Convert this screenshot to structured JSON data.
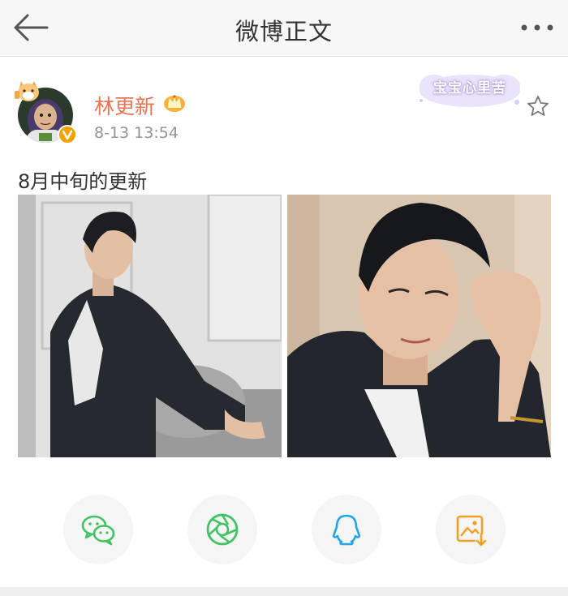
{
  "header": {
    "title": "微博正文",
    "back_icon": "back-arrow-icon",
    "more_icon": "more-dots-icon"
  },
  "post": {
    "author": {
      "name": "林更新",
      "verified_icon": "verified-badge-icon",
      "vip_icon": "crown-icon"
    },
    "timestamp": "8-13 13:54",
    "sticker_text": "宝宝心里苦",
    "text": "8月中旬的更新",
    "photos": [
      "photo-1",
      "photo-2"
    ]
  },
  "share": {
    "items": [
      {
        "icon": "wechat-icon",
        "color": "#3fc464"
      },
      {
        "icon": "moments-icon",
        "color": "#3fc464"
      },
      {
        "icon": "qq-icon",
        "color": "#25a4e6"
      },
      {
        "icon": "save-image-icon",
        "color": "#f0a020"
      }
    ]
  },
  "colors": {
    "accent": "#eb7350",
    "secondary_text": "#939393",
    "header_bg": "#f7f7f7"
  }
}
